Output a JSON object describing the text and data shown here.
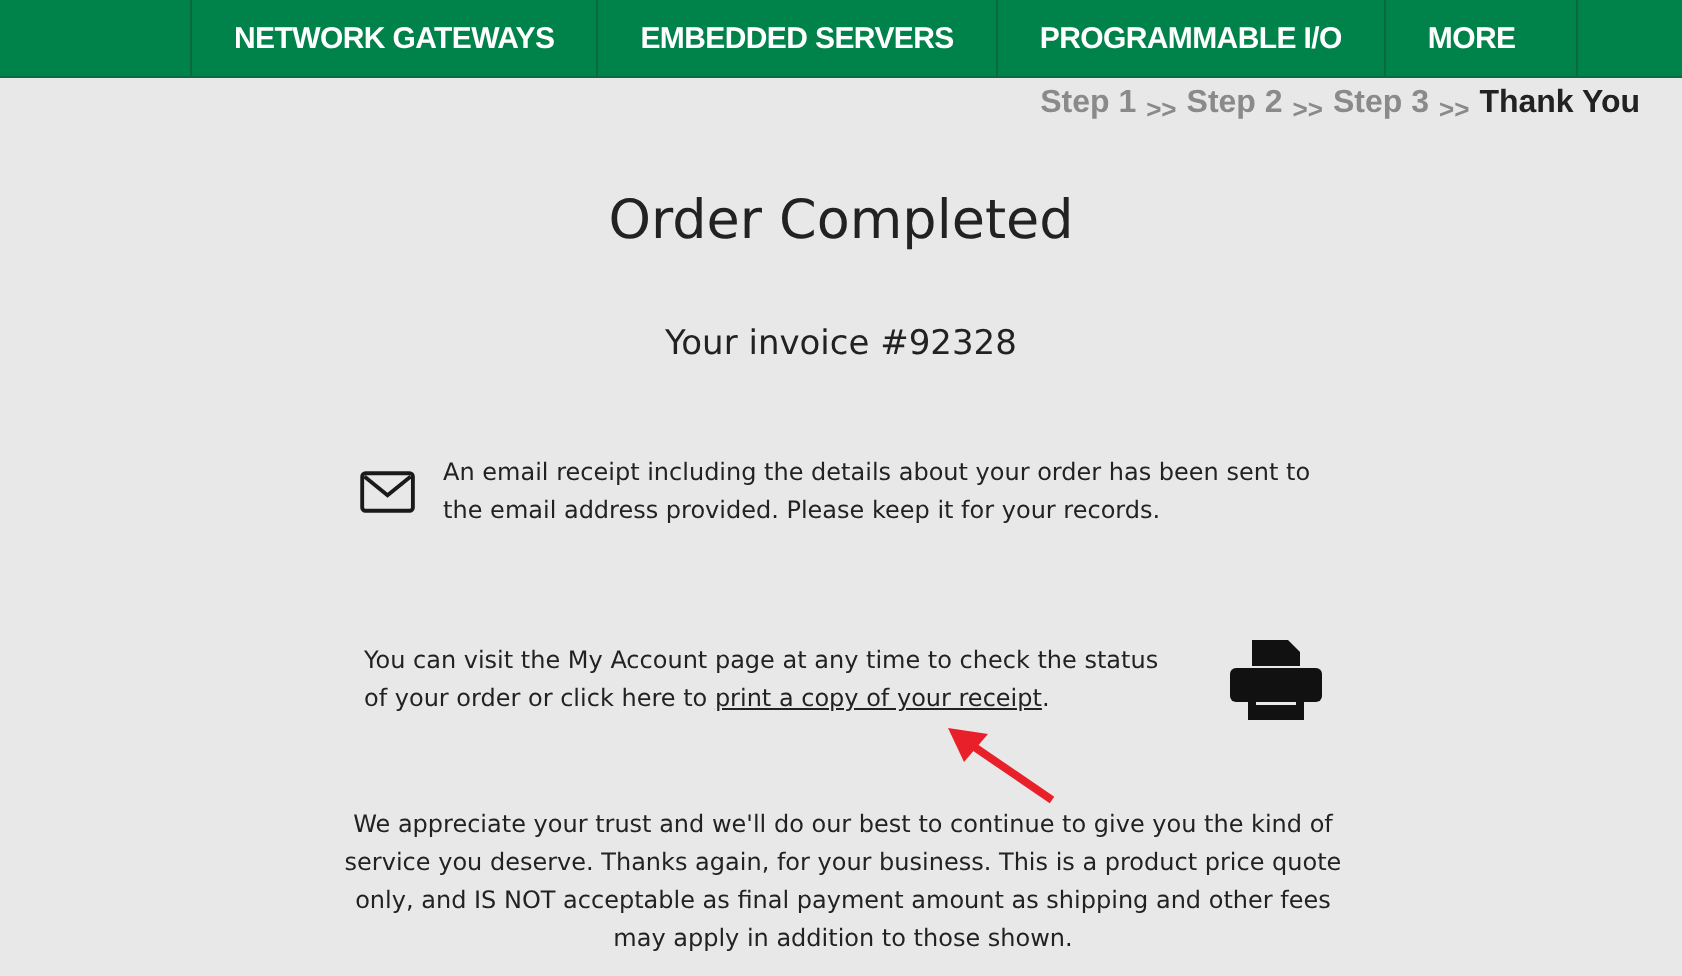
{
  "nav": {
    "items": [
      {
        "label": "NETWORK GATEWAYS"
      },
      {
        "label": "EMBEDDED SERVERS"
      },
      {
        "label": "PROGRAMMABLE I/O"
      },
      {
        "label": "MORE"
      }
    ]
  },
  "steps": [
    {
      "label": "Step 1",
      "selected": false
    },
    {
      "label": ">>",
      "kind": "separator"
    },
    {
      "label": "Step 2",
      "selected": false
    },
    {
      "label": ">>",
      "kind": "separator"
    },
    {
      "label": "Step 3",
      "selected": false
    },
    {
      "label": ">>",
      "kind": "separator"
    },
    {
      "label": "Thank You",
      "selected": true
    }
  ],
  "title": "Order Completed",
  "invoice": "Your invoice #92328",
  "email_notice": "An email receipt including the details about your order has been sent to the email address provided. Please keep it for your records.",
  "account_notice": {
    "text": "You can visit the My Account page at any time to check the status of your order or click here to ",
    "link": "print a copy of your receipt",
    "after": "."
  },
  "closing": "We appreciate your trust and we'll do our best to continue to give you the kind of service you deserve. Thanks again, for your business. This is a product price quote only, and IS NOT acceptable as final payment amount as shipping and other fees may apply in addition to those shown."
}
